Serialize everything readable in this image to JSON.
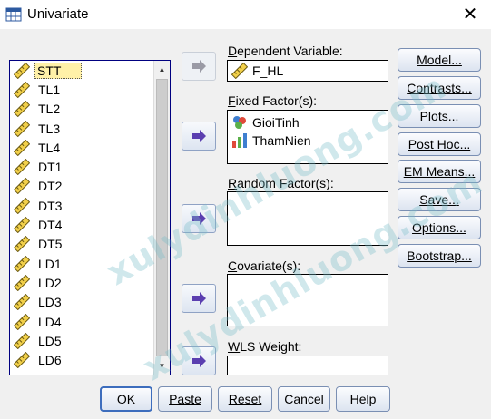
{
  "window": {
    "title": "Univariate",
    "close_glyph": "✕"
  },
  "variables": [
    "STT",
    "TL1",
    "TL2",
    "TL3",
    "TL4",
    "DT1",
    "DT2",
    "DT3",
    "DT4",
    "DT5",
    "LD1",
    "LD2",
    "LD3",
    "LD4",
    "LD5",
    "LD6"
  ],
  "selected_variable": "STT",
  "dependent": {
    "label_prefix": "D",
    "label_rest": "ependent Variable:",
    "value": "F_HL"
  },
  "fixed": {
    "label_prefix": "F",
    "label_rest": "ixed Factor(s):",
    "items": [
      "GioiTinh",
      "ThamNien"
    ]
  },
  "random": {
    "label_prefix": "R",
    "label_rest": "andom Factor(s):"
  },
  "covariate": {
    "label_prefix": "C",
    "label_rest": "ovariate(s):"
  },
  "wls": {
    "label_prefix": "W",
    "label_rest": "LS Weight:"
  },
  "side_buttons": [
    "Model...",
    "Contrasts...",
    "Plots...",
    "Post Hoc...",
    "EM Means...",
    "Save...",
    "Options...",
    "Bootstrap..."
  ],
  "bottom_buttons": [
    "OK",
    "Paste",
    "Reset",
    "Cancel",
    "Help"
  ],
  "watermark": [
    "xulydinhluong.com",
    "xulydinhluong.com"
  ],
  "colors": {
    "arrow": "#5b3fb0",
    "list_border": "#000080",
    "selection": "#fff1a8"
  }
}
